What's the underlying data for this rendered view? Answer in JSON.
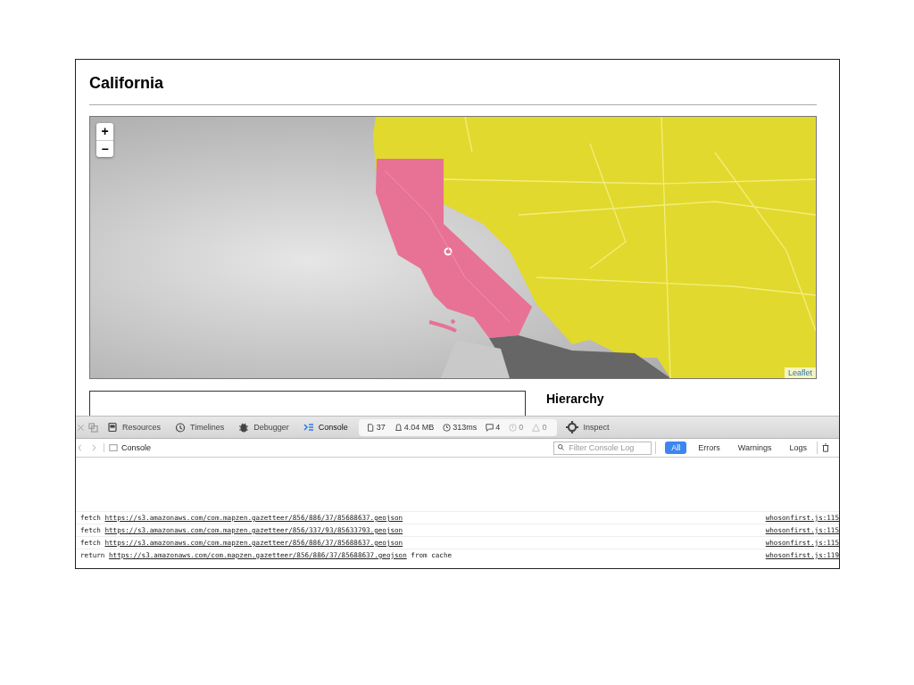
{
  "page": {
    "title": "California",
    "section_heading": "Hierarchy"
  },
  "map": {
    "zoom_in": "+",
    "zoom_out": "−",
    "attribution": "Leaflet"
  },
  "devtools": {
    "tabs": [
      {
        "label": "Resources",
        "kind": "resources",
        "selected": false
      },
      {
        "label": "Timelines",
        "kind": "timelines",
        "selected": false
      },
      {
        "label": "Debugger",
        "kind": "debugger",
        "selected": false
      },
      {
        "label": "Console",
        "kind": "console",
        "selected": true
      }
    ],
    "stats": [
      {
        "kind": "document",
        "text": "37",
        "disabled": false
      },
      {
        "kind": "memory",
        "text": "4.04 MB",
        "disabled": false
      },
      {
        "kind": "time",
        "text": "313ms",
        "disabled": false
      },
      {
        "kind": "log",
        "text": "4",
        "disabled": false
      },
      {
        "kind": "error",
        "text": "0",
        "disabled": true
      },
      {
        "kind": "warning",
        "text": "0",
        "disabled": true
      }
    ],
    "inspect": "Inspect",
    "breadcrumb": "Console",
    "filter": {
      "placeholder": "Filter Console Log"
    },
    "filters": [
      {
        "label": "All",
        "selected": true
      },
      {
        "label": "Errors",
        "selected": false
      },
      {
        "label": "Warnings",
        "selected": false
      },
      {
        "label": "Logs",
        "selected": false
      }
    ],
    "messages": [
      {
        "verb": "fetch",
        "url": "https://s3.amazonaws.com/com.mapzen.gazetteer/856/886/37/85688637.geojson",
        "source": "whosonfirst.js:115"
      },
      {
        "verb": "fetch",
        "url": "https://s3.amazonaws.com/com.mapzen.gazetteer/856/337/93/85633793.geojson",
        "source": "whosonfirst.js:115"
      },
      {
        "verb": "fetch",
        "url": "https://s3.amazonaws.com/com.mapzen.gazetteer/856/886/37/85688637.geojson",
        "source": "whosonfirst.js:115"
      },
      {
        "verb": "return",
        "url": "https://s3.amazonaws.com/com.mapzen.gazetteer/856/886/37/85688637.geojson",
        "suffix": "from cache",
        "source": "whosonfirst.js:119"
      }
    ]
  }
}
